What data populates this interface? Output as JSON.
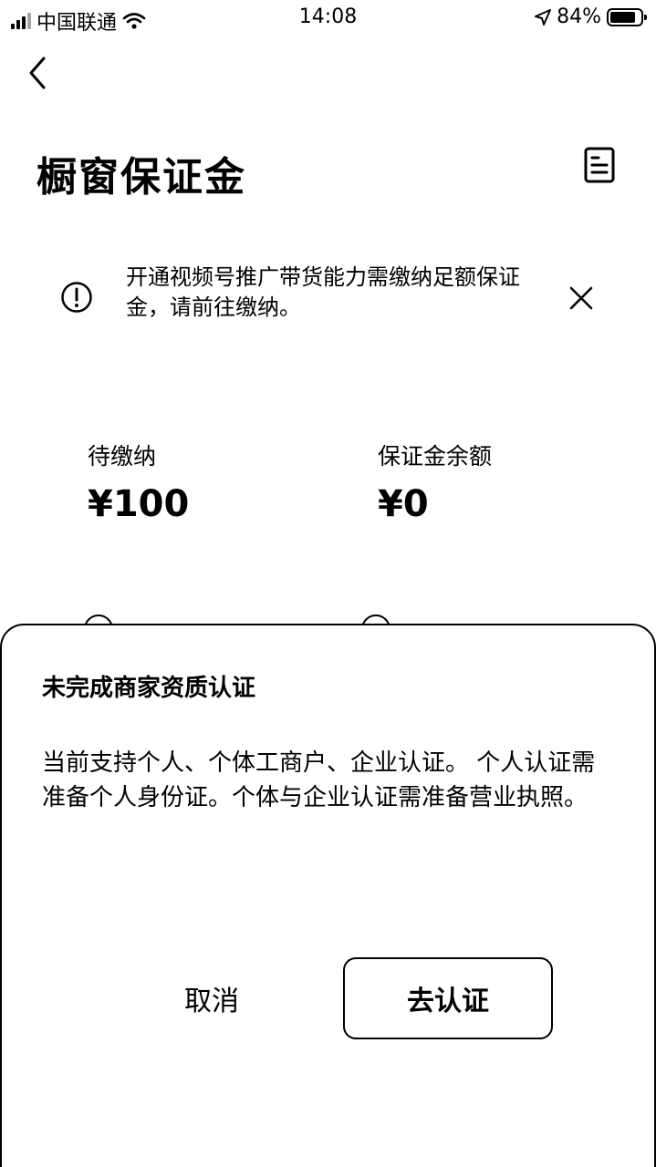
{
  "status_bar": {
    "carrier": "中国联通",
    "time": "14:08",
    "battery_percent": "84%",
    "battery_level": 0.84,
    "icons": [
      "signal-icon",
      "wifi-icon",
      "location-arrow-icon",
      "battery-icon"
    ]
  },
  "header": {
    "title": "橱窗保证金",
    "back_icon": "chevron-left-icon",
    "doc_icon": "document-list-icon"
  },
  "notice": {
    "text": "开通视频号推广带货能力需缴纳足额保证金，请前往缴纳。",
    "icon": "exclamation-circle-icon",
    "close_icon": "close-icon"
  },
  "stats": {
    "pending_label": "待缴纳",
    "pending_value": "¥100",
    "balance_label": "保证金余额",
    "balance_value": "¥0"
  },
  "dialog": {
    "title": "未完成商家资质认证",
    "body": "当前支持个人、个体工商户、企业认证。 个人认证需准备个人身份证。个体与企业认证需准备营业执照。",
    "cancel_label": "取消",
    "confirm_label": "去认证"
  },
  "colors": {
    "background": "#ffffff",
    "text": "#000000",
    "border": "#000000"
  }
}
